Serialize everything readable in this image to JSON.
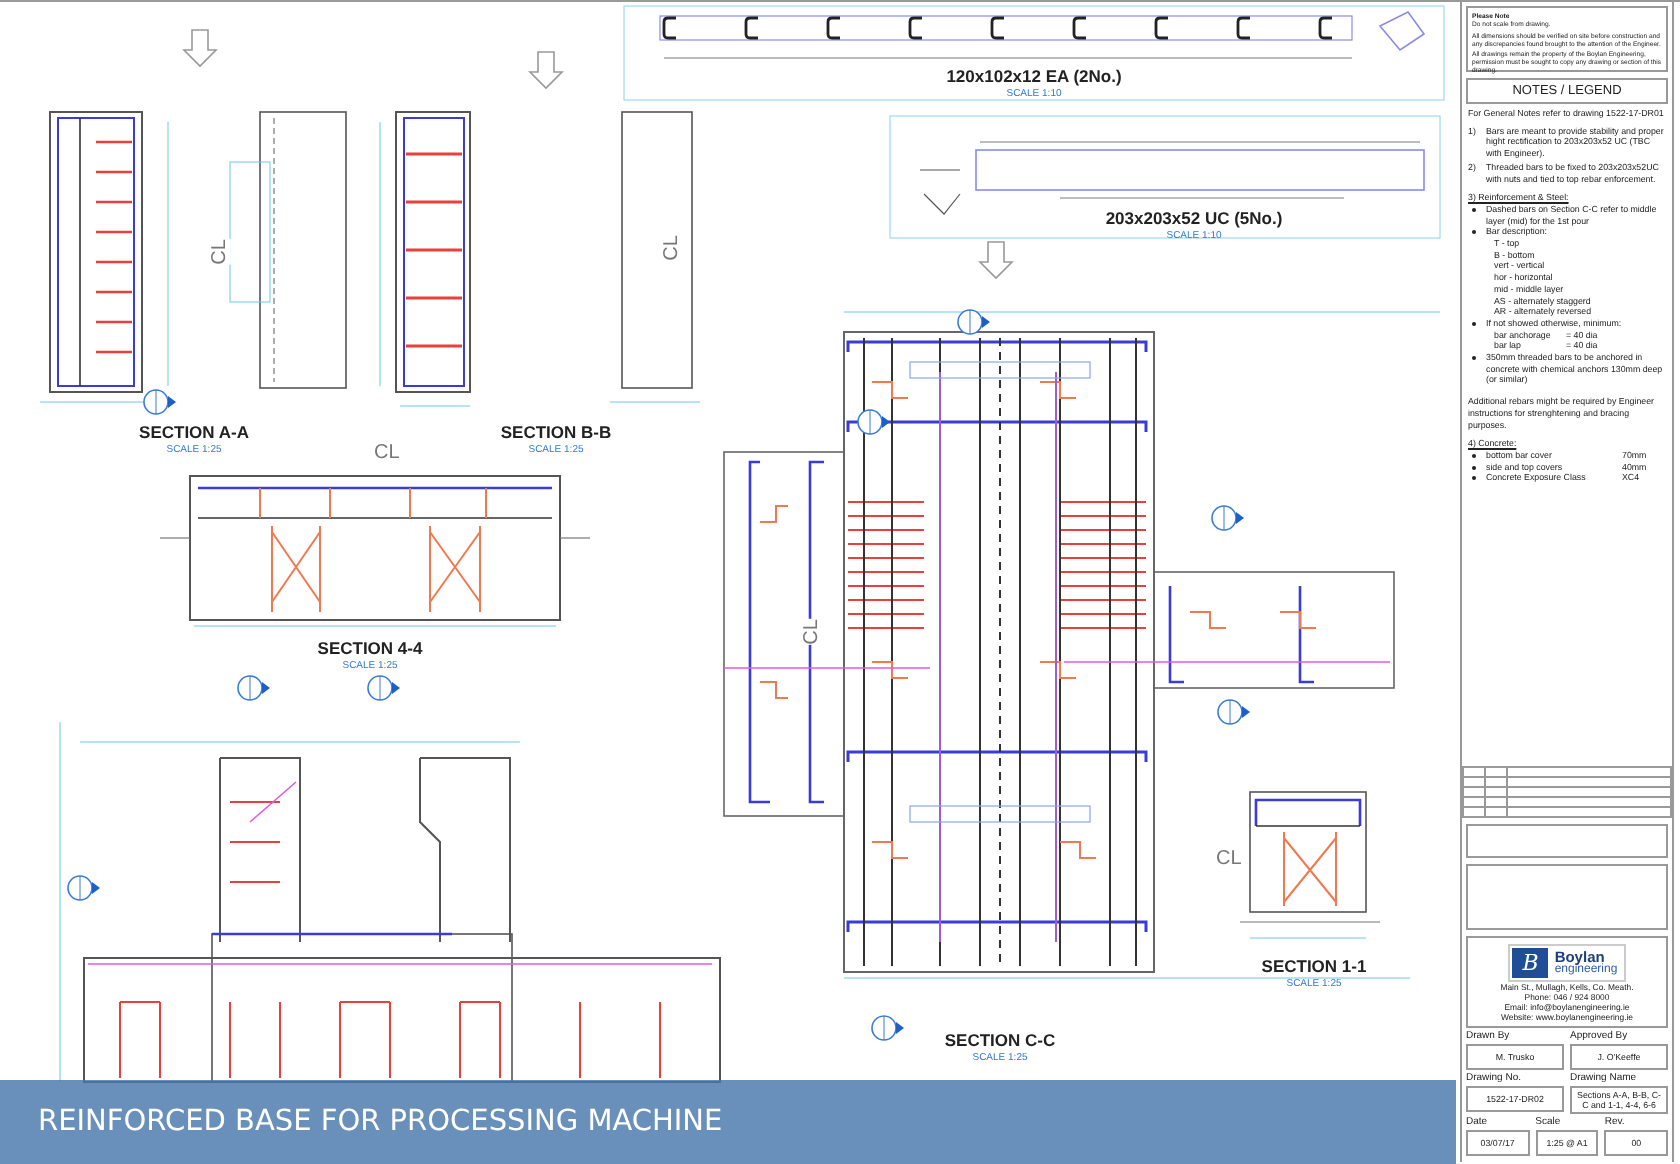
{
  "drawings": [
    {
      "title": "SECTION A-A",
      "scale": "SCALE 1:25"
    },
    {
      "title": "SECTION B-B",
      "scale": "SCALE 1:25"
    },
    {
      "title": "SECTION 4-4",
      "scale": "SCALE 1:25"
    },
    {
      "title": "120x102x12 EA (2No.)",
      "scale": "SCALE 1:10"
    },
    {
      "title": "203x203x52 UC (5No.)",
      "scale": "SCALE 1:10"
    },
    {
      "title": "SECTION C-C",
      "scale": "SCALE 1:25"
    },
    {
      "title": "SECTION 1-1",
      "scale": "SCALE 1:25"
    }
  ],
  "centre_lines": [
    "CL",
    "CL",
    "CL",
    "CL",
    "CL"
  ],
  "please_note": {
    "heading": "Please Note",
    "lines": [
      "Do not scale from drawing.",
      "All dimensions should be verified on site before construction and any discrepancies found brought to the attention of the Engineer.",
      "All drawings remain the property of the Boylan Engineering, permission must be sought to copy any drawing or section of this drawing."
    ]
  },
  "notes": {
    "title": "NOTES / LEGEND",
    "intro": "For General Notes refer to drawing 1522-17-DR01",
    "items": [
      {
        "kind": "numbered",
        "marker": "1)",
        "text": "Bars are meant to provide stability and proper hight rectification to 203x203x52 UC (TBC with Engineer)."
      },
      {
        "kind": "numbered",
        "marker": "2)",
        "text": "Threaded bars to be fixed to 203x203x52UC with nuts and tied to top rebar enforcement."
      },
      {
        "kind": "heading",
        "text": "3) Reinforcement & Steel:"
      },
      {
        "kind": "bullet",
        "text": "Dashed bars on Section C-C refer to middle layer (mid) for the 1st pour"
      },
      {
        "kind": "bullet",
        "text": "Bar description:",
        "sublines": [
          "T - top",
          "B - bottom",
          "vert - vertical",
          "hor - horizontal",
          "mid - middle layer",
          "AS - alternately staggerd",
          "AR - alternately reversed"
        ]
      },
      {
        "kind": "bullet",
        "text": "If not showed otherwise, minimum:",
        "rows": [
          {
            "label": "bar anchorage",
            "value": "= 40 dia"
          },
          {
            "label": "bar lap",
            "value": "= 40 dia"
          }
        ]
      },
      {
        "kind": "bullet",
        "text": "350mm threaded bars to be anchored in concrete with chemical anchors 130mm deep (or similar)"
      },
      {
        "kind": "paragraph",
        "text": "Additional rebars might be required by Engineer instructions for strenghtening and bracing purposes."
      },
      {
        "kind": "heading",
        "text": "4) Concrete:"
      },
      {
        "kind": "bullet",
        "text": "bottom bar cover",
        "value": "70mm"
      },
      {
        "kind": "bullet",
        "text": "side and top covers",
        "value": "40mm"
      },
      {
        "kind": "bullet",
        "text": "Concrete Exposure Class",
        "value": "XC4"
      }
    ]
  },
  "title_block": {
    "logo_mark": "B",
    "company": "Boylan",
    "company_sub": "engineering",
    "address": [
      "Main St., Mullagh, Kells, Co. Meath.",
      "Phone: 046 / 924 8000",
      "Email: info@boylanengineering.ie",
      "Website: www.boylanengineering.ie"
    ],
    "fields": [
      [
        {
          "label": "Drawn By",
          "value": "M. Trusko"
        },
        {
          "label": "Approved By",
          "value": "J. O'Keeffe"
        }
      ],
      [
        {
          "label": "Drawing No.",
          "value": "1522-17-DR02"
        },
        {
          "label": "Drawing Name",
          "value": "Sections A-A, B-B, C-C and 1-1, 4-4, 6-6"
        }
      ],
      [
        {
          "label": "Date",
          "value": "03/07/17"
        },
        {
          "label": "Scale",
          "value": "1:25 @ A1"
        },
        {
          "label": "Rev.",
          "value": "00"
        }
      ]
    ]
  },
  "caption": "REINFORCED BASE FOR PROCESSING MACHINE"
}
